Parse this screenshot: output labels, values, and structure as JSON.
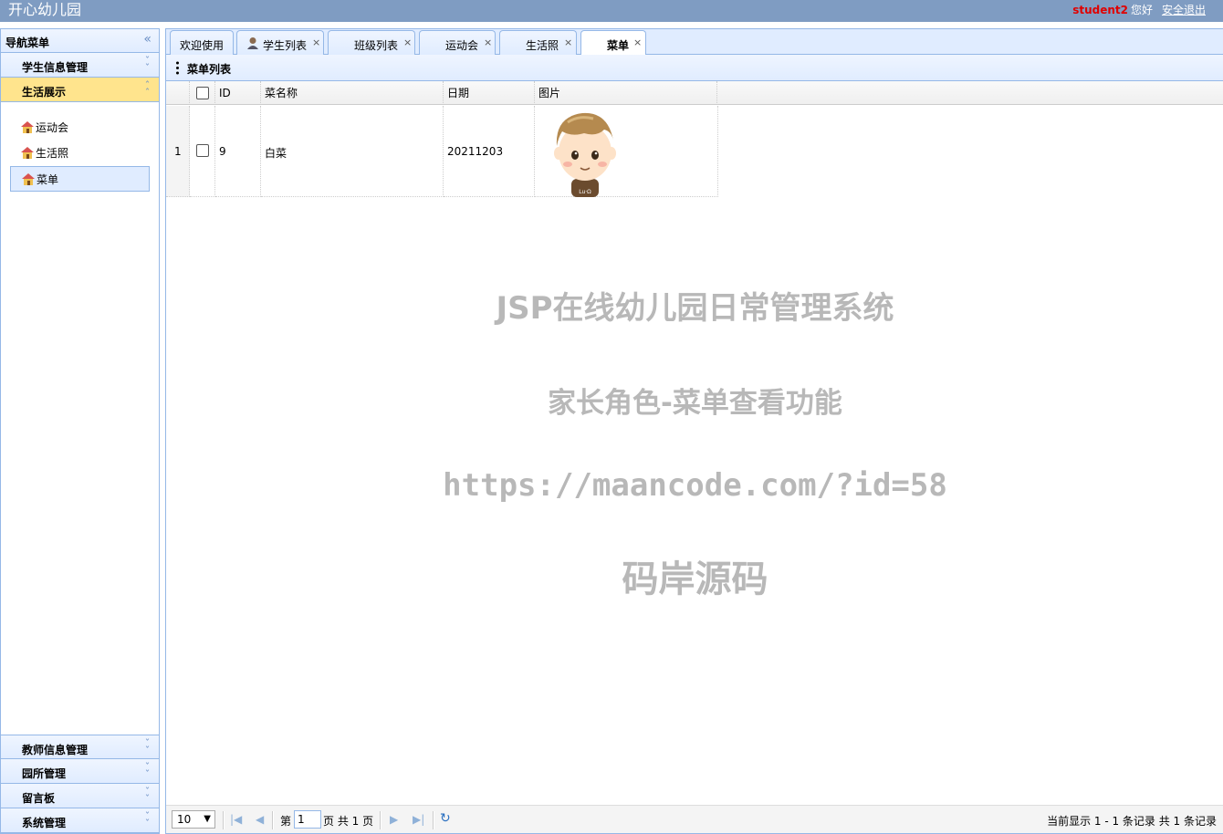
{
  "app": {
    "title": "开心幼儿园",
    "user": "student2",
    "greeting": "您好",
    "logout": "安全退出"
  },
  "nav": {
    "title": "导航菜单",
    "groups": [
      {
        "label": "学生信息管理"
      },
      {
        "label": "生活展示"
      },
      {
        "label": "教师信息管理"
      },
      {
        "label": "园所管理"
      },
      {
        "label": "留言板"
      },
      {
        "label": "系统管理"
      }
    ],
    "items": [
      {
        "label": "运动会"
      },
      {
        "label": "生活照"
      },
      {
        "label": "菜单"
      }
    ]
  },
  "tabs": [
    {
      "label": "欢迎使用"
    },
    {
      "label": "学生列表"
    },
    {
      "label": "班级列表"
    },
    {
      "label": "运动会"
    },
    {
      "label": "生活照"
    },
    {
      "label": "菜单"
    }
  ],
  "panel": {
    "title": "菜单列表"
  },
  "grid": {
    "columns": [
      "ID",
      "菜名称",
      "日期",
      "图片"
    ],
    "rows": [
      {
        "rownum": "1",
        "id": "9",
        "name": "白菜",
        "date": "20211203"
      }
    ]
  },
  "watermark": {
    "line1": "JSP在线幼儿园日常管理系统",
    "line2": "家长角色-菜单查看功能",
    "line3": "https://maancode.com/?id=58",
    "line4": "码岸源码"
  },
  "pager": {
    "page_size": "10",
    "page_prefix": "第",
    "page_value": "1",
    "page_suffix": "页 共 1 页",
    "info": "当前显示 1 - 1 条记录 共 1 条记录"
  }
}
